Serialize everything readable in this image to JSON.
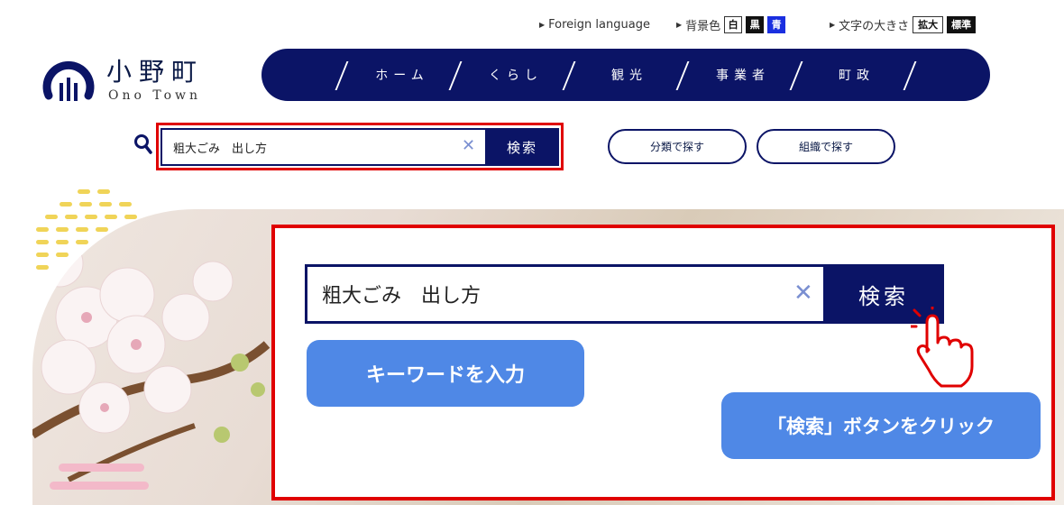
{
  "utility": {
    "foreign_language": "Foreign language",
    "background_color_label": "背景色",
    "bg_white": "白",
    "bg_black": "黒",
    "bg_blue": "青",
    "text_size_label": "文字の大きさ",
    "size_enlarge": "拡大",
    "size_standard": "標準"
  },
  "logo": {
    "name_ja": "小野町",
    "name_en": "Ono Town"
  },
  "nav": {
    "items": [
      {
        "label": "ホーム"
      },
      {
        "label": "くらし"
      },
      {
        "label": "観光"
      },
      {
        "label": "事業者"
      },
      {
        "label": "町政"
      }
    ]
  },
  "search": {
    "query": "粗大ごみ　出し方",
    "clear_glyph": "✕",
    "button_label": "検索"
  },
  "filters": {
    "by_category": "分類で探す",
    "by_organization": "組織で探す"
  },
  "tutorial": {
    "query": "粗大ごみ　出し方",
    "button_label": "検索",
    "step_keyword": "キーワードを入力",
    "step_click": "「検索」ボタンをクリック"
  },
  "colors": {
    "navy": "#0b1466",
    "highlight_red": "#e00000",
    "callout_blue": "#4f88e6"
  }
}
